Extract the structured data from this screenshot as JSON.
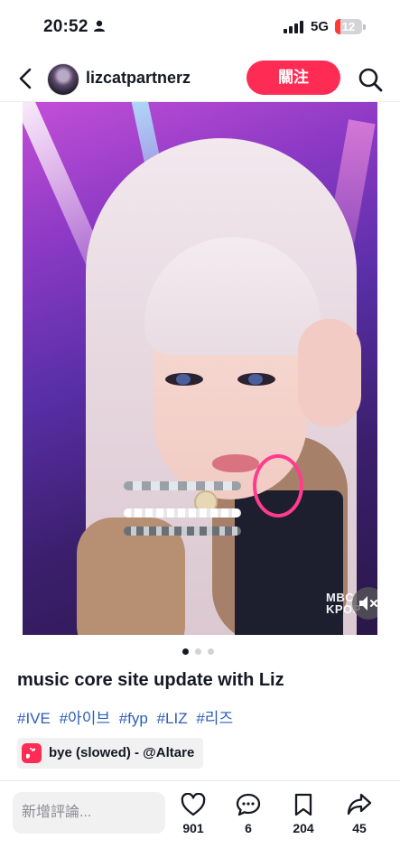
{
  "status_bar": {
    "time": "20:52",
    "network": "5G",
    "battery": "12",
    "battery_level_percent": 12,
    "battery_color": "#ff3b30"
  },
  "header": {
    "username": "lizcatpartnerz",
    "follow_label": "關注",
    "icons": [
      "back-arrow-icon",
      "search-icon"
    ],
    "follow_color": "#fe2c55"
  },
  "media": {
    "watermark_line1": "MBC",
    "watermark_line2": "KPOP",
    "mute_icon": "speaker-muted-icon",
    "carousel": {
      "count": 3,
      "active_index": 1
    }
  },
  "post": {
    "caption": "music core site update with Liz",
    "hashtags": [
      "#IVE",
      "#아이브",
      "#fyp",
      "#LIZ",
      "#리즈"
    ],
    "hashtag_color": "#2b5db9",
    "music": "bye (slowed) - @Altare"
  },
  "bottom_bar": {
    "comment_placeholder": "新增評論...",
    "likes": "901",
    "comments": "6",
    "saves": "204",
    "shares": "45"
  }
}
